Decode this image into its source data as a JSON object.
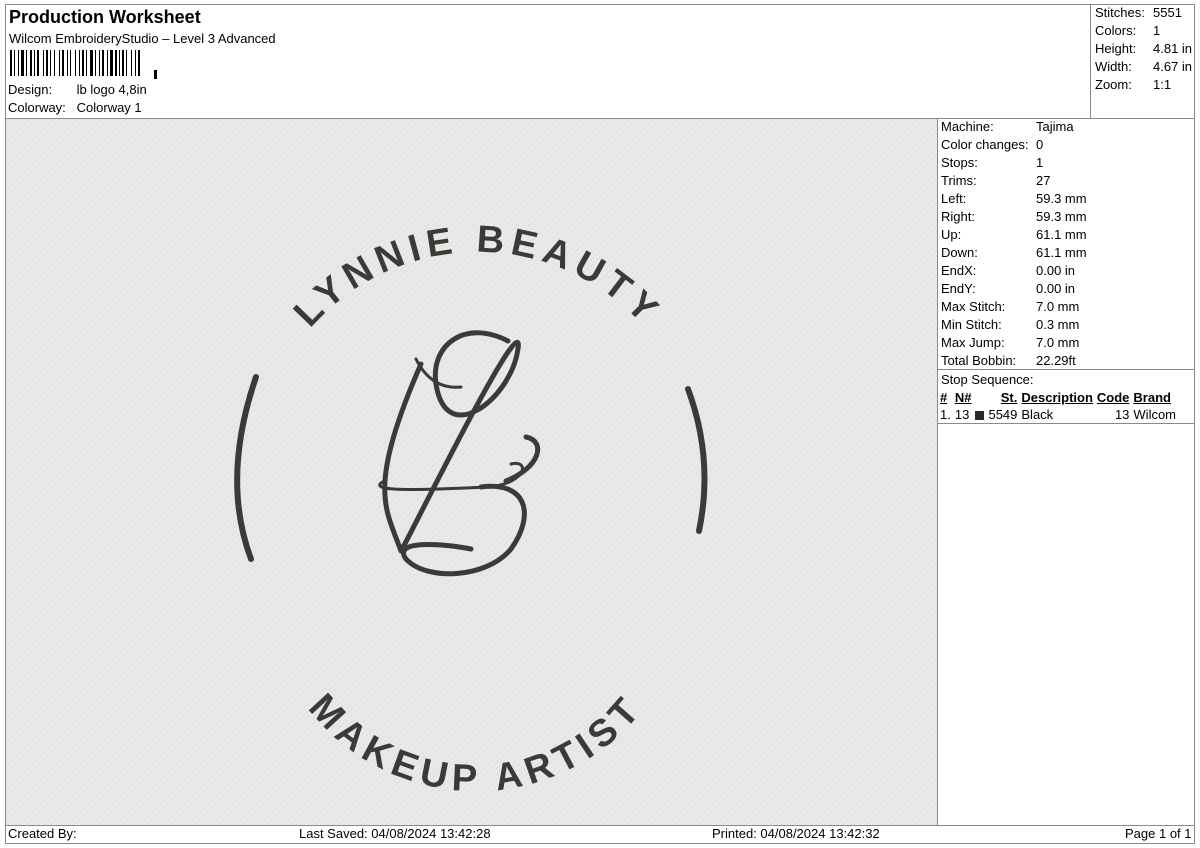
{
  "header": {
    "title": "Production Worksheet",
    "software": "Wilcom EmbroideryStudio – Level 3 Advanced",
    "design_label": "Design:",
    "design_value": "lb logo 4,8in",
    "colorway_label": "Colorway:",
    "colorway_value": "Colorway 1"
  },
  "summary": [
    {
      "label": "Stitches:",
      "value": "5551"
    },
    {
      "label": "Colors:",
      "value": "1"
    },
    {
      "label": "Height:",
      "value": "4.81 in"
    },
    {
      "label": "Width:",
      "value": "4.67 in"
    },
    {
      "label": "Zoom:",
      "value": "1:1"
    }
  ],
  "details": [
    {
      "label": "Machine:",
      "value": "Tajima"
    },
    {
      "label": "Color changes:",
      "value": "0"
    },
    {
      "label": "Stops:",
      "value": "1"
    },
    {
      "label": "Trims:",
      "value": "27"
    },
    {
      "label": "Left:",
      "value": "59.3 mm"
    },
    {
      "label": "Right:",
      "value": "59.3 mm"
    },
    {
      "label": "Up:",
      "value": "61.1 mm"
    },
    {
      "label": "Down:",
      "value": "61.1 mm"
    },
    {
      "label": "EndX:",
      "value": "0.00 in"
    },
    {
      "label": "EndY:",
      "value": "0.00 in"
    },
    {
      "label": "Max Stitch:",
      "value": "7.0 mm"
    },
    {
      "label": "Min Stitch:",
      "value": "0.3 mm"
    },
    {
      "label": "Max Jump:",
      "value": "7.0 mm"
    },
    {
      "label": "Total Bobbin:",
      "value": "22.29ft"
    }
  ],
  "stop_sequence": {
    "title": "Stop Sequence:",
    "headers": {
      "num": "#",
      "n": "N#",
      "st": "St.",
      "desc": "Description",
      "code": "Code",
      "brand": "Brand"
    },
    "rows": [
      {
        "num": "1.",
        "n": "13",
        "swatch": "#2a2a2a",
        "st": "5549",
        "desc": "Black",
        "code": "13",
        "brand": "Wilcom"
      }
    ]
  },
  "design": {
    "top_text": "LYNNIE BEAUTY",
    "bottom_text": "MAKEUP ARTIST",
    "thread_color": "#3b3a36",
    "fabric_color": "#e9e9e9"
  },
  "footer": {
    "created_by": "Created By:",
    "last_saved": "Last Saved: 04/08/2024 13:42:28",
    "printed": "Printed: 04/08/2024 13:42:32",
    "page": "Page 1 of 1"
  }
}
